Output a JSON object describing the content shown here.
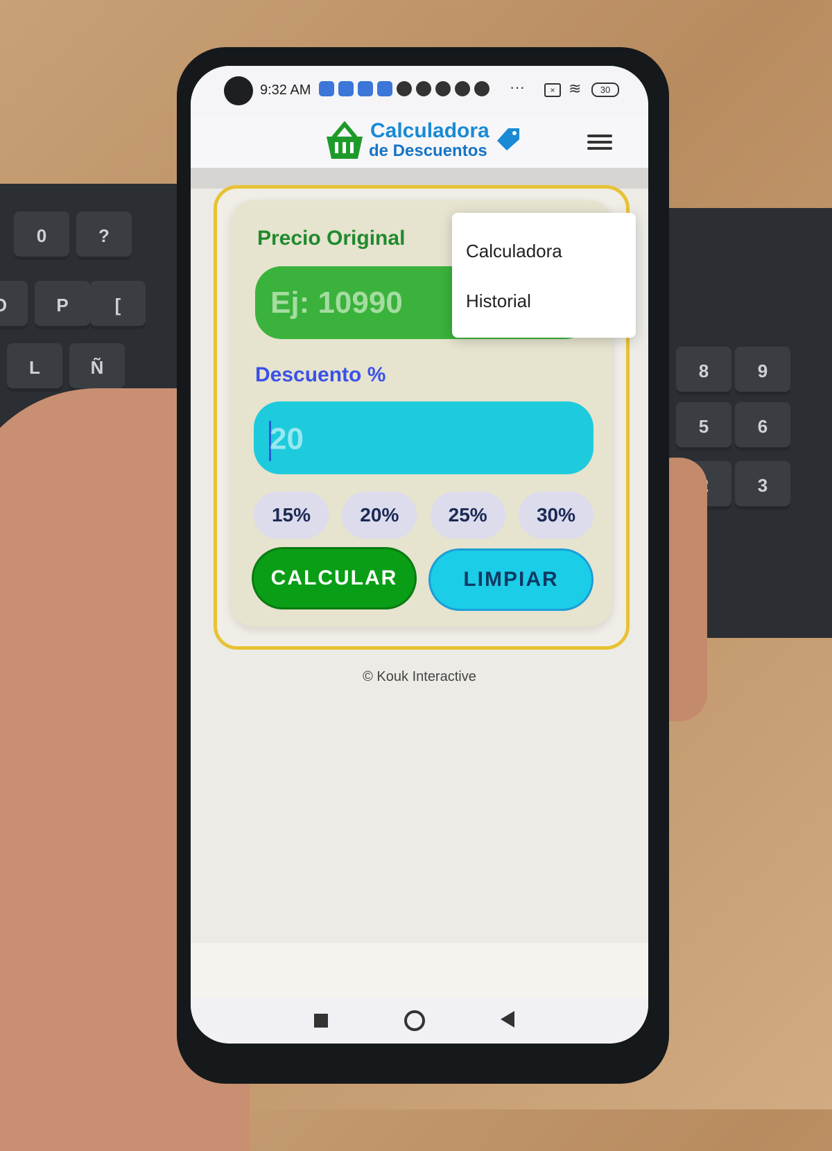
{
  "status_bar": {
    "time": "9:32 AM",
    "battery": "30"
  },
  "header": {
    "logo_line1": "Calculadora",
    "logo_line2": "de Descuentos",
    "logo_icon": "shopping-basket-icon",
    "tag_icon": "price-tag-icon",
    "menu_icon": "hamburger-menu-icon"
  },
  "menu": {
    "items": [
      "Calculadora",
      "Historial"
    ]
  },
  "form": {
    "price_label": "Precio Original",
    "price_placeholder": "Ej: 10990",
    "discount_label": "Descuento %",
    "discount_value": "20",
    "presets": [
      "15%",
      "20%",
      "25%",
      "30%"
    ],
    "calc_button": "CALCULAR",
    "clear_button": "LIMPIAR"
  },
  "footer": {
    "text": "© Kouk Interactive"
  },
  "colors": {
    "price_input": "#3ab23c",
    "discount_input": "#1ecbdc",
    "calc_button": "#0a9e16",
    "clear_button": "#1ccde8",
    "card_border": "#e8c233"
  }
}
